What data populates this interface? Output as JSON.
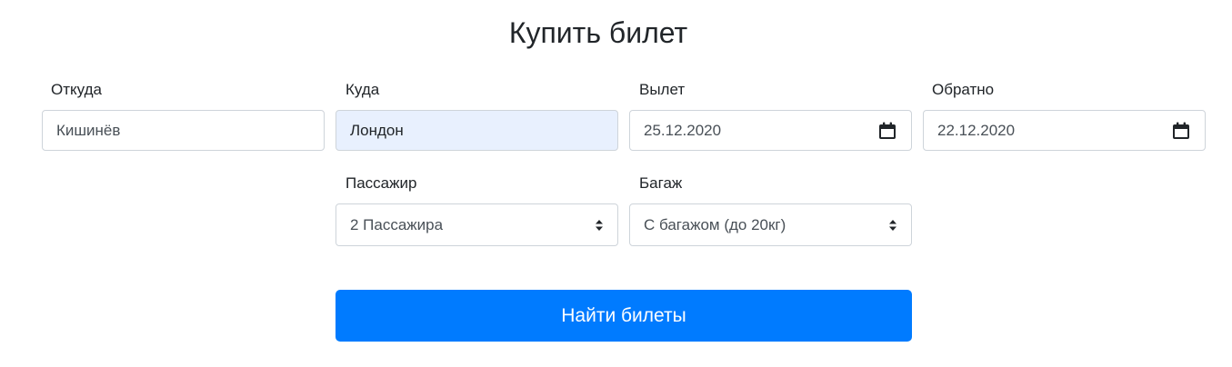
{
  "form": {
    "title": "Купить билет",
    "from": {
      "label": "Откуда",
      "value": "Кишинёв"
    },
    "to": {
      "label": "Куда",
      "value": "Лондон"
    },
    "departure": {
      "label": "Вылет",
      "value": "25.12.2020",
      "icon": "calendar-icon"
    },
    "return": {
      "label": "Обратно",
      "value": "22.12.2020",
      "icon": "calendar-icon"
    },
    "passengers": {
      "label": "Пассажир",
      "value": "2 Пассажира",
      "icon": "select-caret-icon"
    },
    "baggage": {
      "label": "Багаж",
      "value": "С багажом (до 20кг)",
      "icon": "select-caret-icon"
    },
    "submit_label": "Найти билеты"
  },
  "colors": {
    "primary": "#007bff",
    "autofill_bg": "#e8f0fe",
    "border": "#ced4da",
    "text": "#212529"
  }
}
